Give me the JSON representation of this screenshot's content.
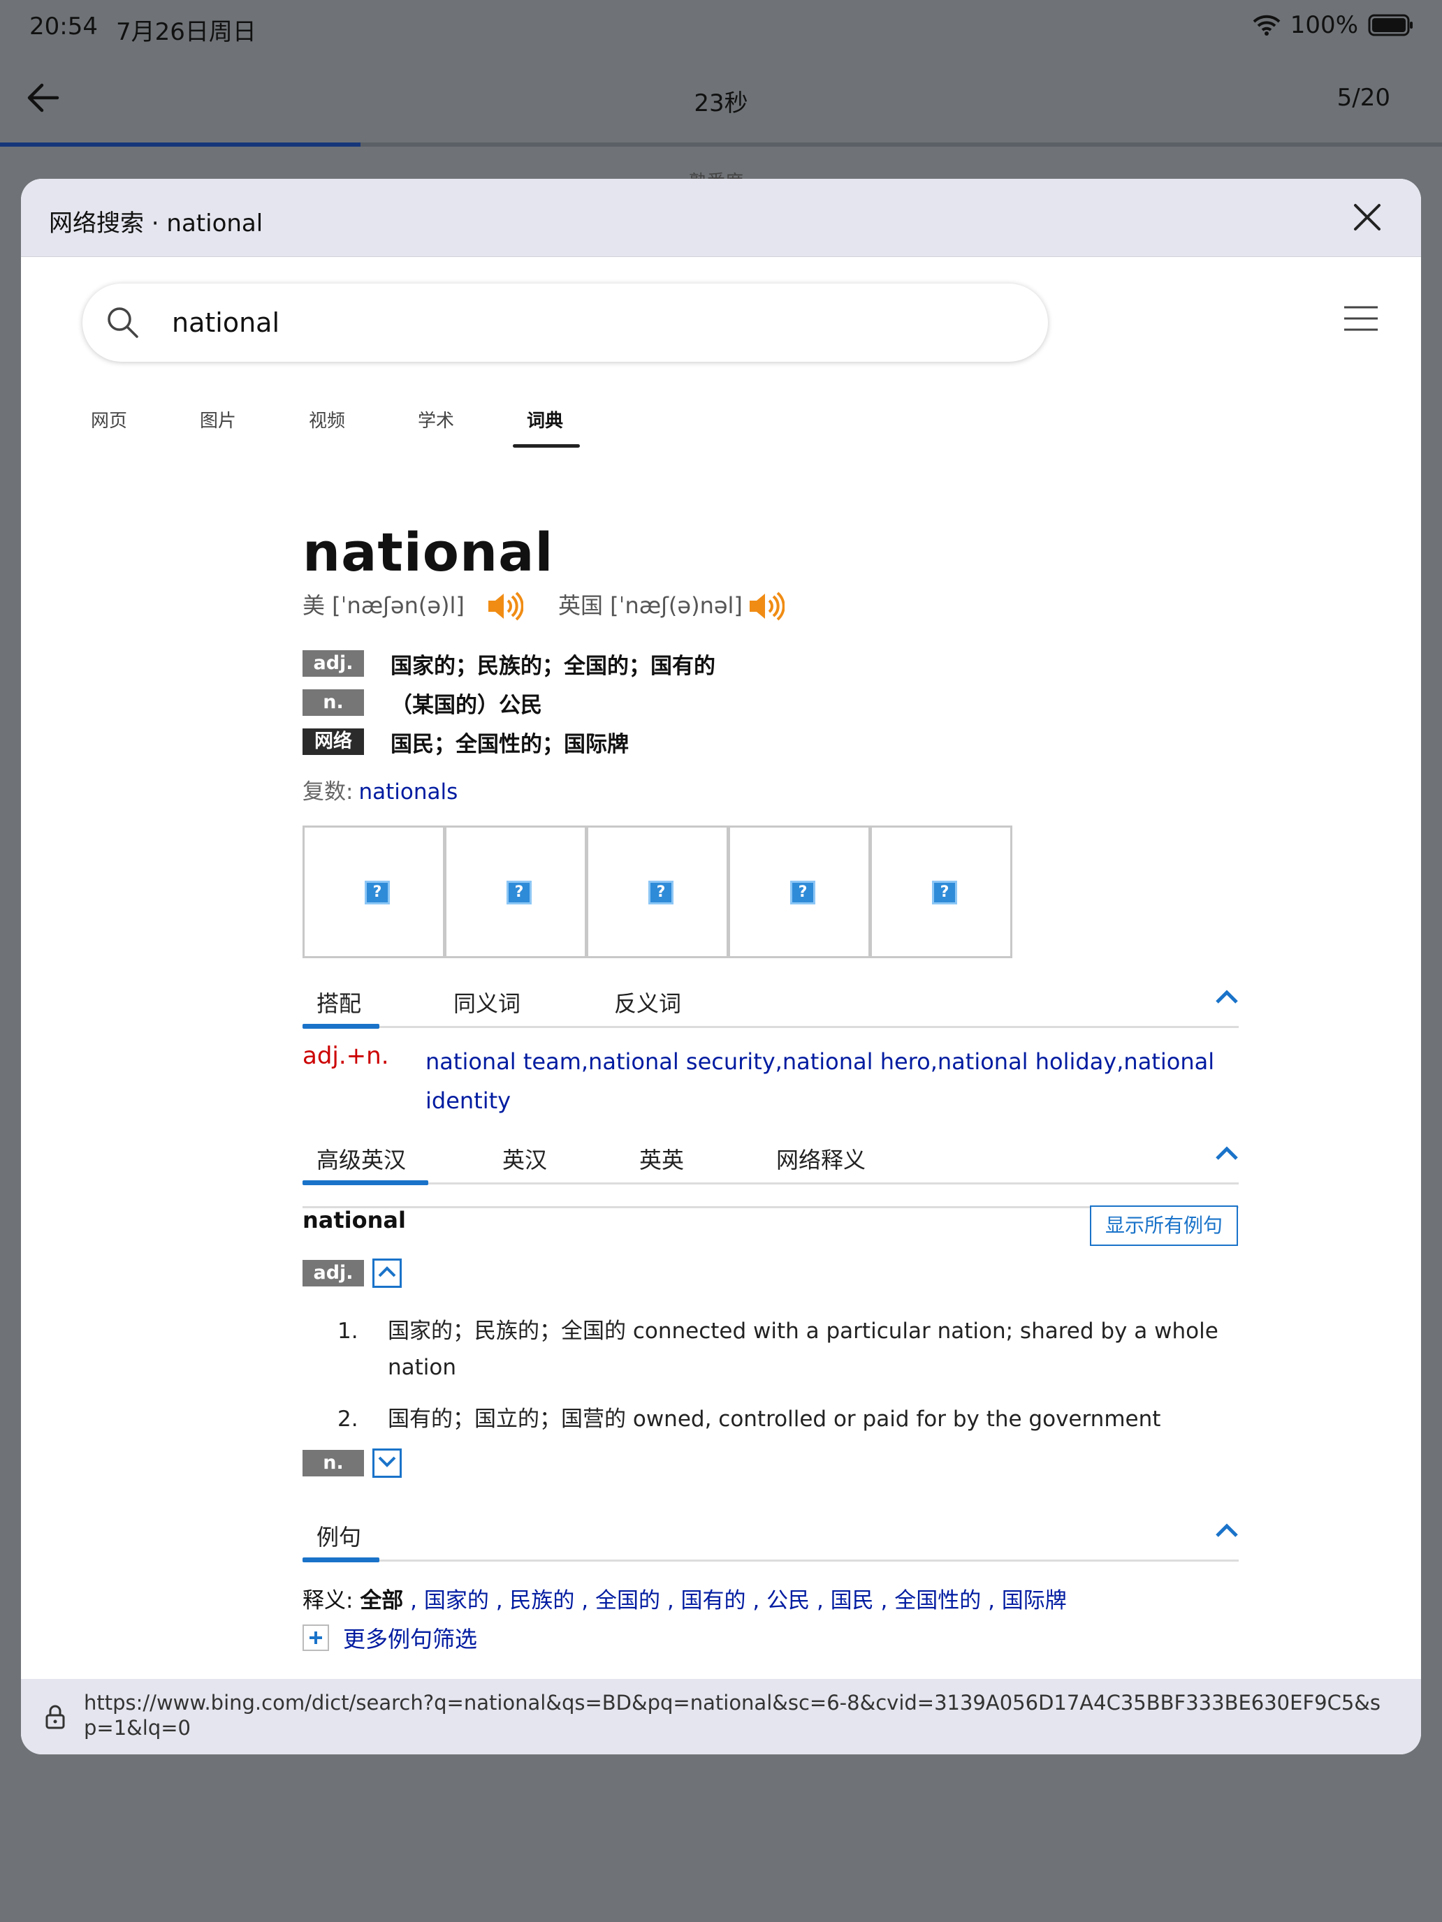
{
  "status_bar": {
    "time": "20:54",
    "date": "7月26日周日",
    "battery": "100%"
  },
  "app_bar": {
    "timer": "23秒",
    "progress_count": "5/20",
    "progress_fraction": 0.25,
    "peek_text": "熟悉度"
  },
  "modal": {
    "title": "网络搜索 · national",
    "url": "https://www.bing.com/dict/search?q=national&qs=BD&pq=national&sc=6-8&cvid=3139A056D17A4C35BBF333BE630EF9C5&sp=1&lq=0"
  },
  "search": {
    "value": "national"
  },
  "nav_tabs": [
    "网页",
    "图片",
    "视频",
    "学术",
    "词典"
  ],
  "nav_active": "词典",
  "entry": {
    "headword": "national",
    "pron_us": "美 [ˈnæʃən(ə)l]",
    "pron_uk": "英国 [ˈnæʃ(ə)nəl]",
    "definitions": [
      {
        "pos": "adj.",
        "text": "国家的；民族的；全国的；国有的"
      },
      {
        "pos": "n.",
        "text": "（某国的）公民"
      },
      {
        "pos": "网络",
        "text": "国民；全国性的；国际牌"
      }
    ],
    "plural_label": "复数:",
    "plural_value": "nationals",
    "image_placeholders": [
      "?",
      "?",
      "?",
      "?",
      "?"
    ]
  },
  "collocation_section": {
    "tabs": [
      "搭配",
      "同义词",
      "反义词"
    ],
    "pos": "adj.+n.",
    "line1": "national team,national security,national hero,national holiday,national",
    "line2": "identity"
  },
  "dictionary_section": {
    "tabs": [
      "高级英汉",
      "英汉",
      "英英",
      "网络释义"
    ],
    "word": "national",
    "show_all_label": "显示所有例句",
    "adj_label": "adj.",
    "n_label": "n.",
    "senses": [
      {
        "num": "1.",
        "text": "国家的；民族的；全国的 connected with a particular nation; shared by a whole nation"
      },
      {
        "num": "2.",
        "text": "国有的；国立的；国营的 owned, controlled or paid for by the government"
      }
    ]
  },
  "examples_section": {
    "tab": "例句",
    "shiyi_label": "释义: ",
    "shiyi_all": "全部",
    "shiyi_links": " , 国家的 , 民族的 , 全国的 , 国有的 , 公民 , 国民 , 全国性的 , 国际牌",
    "more_filter": "更多例句筛选"
  }
}
